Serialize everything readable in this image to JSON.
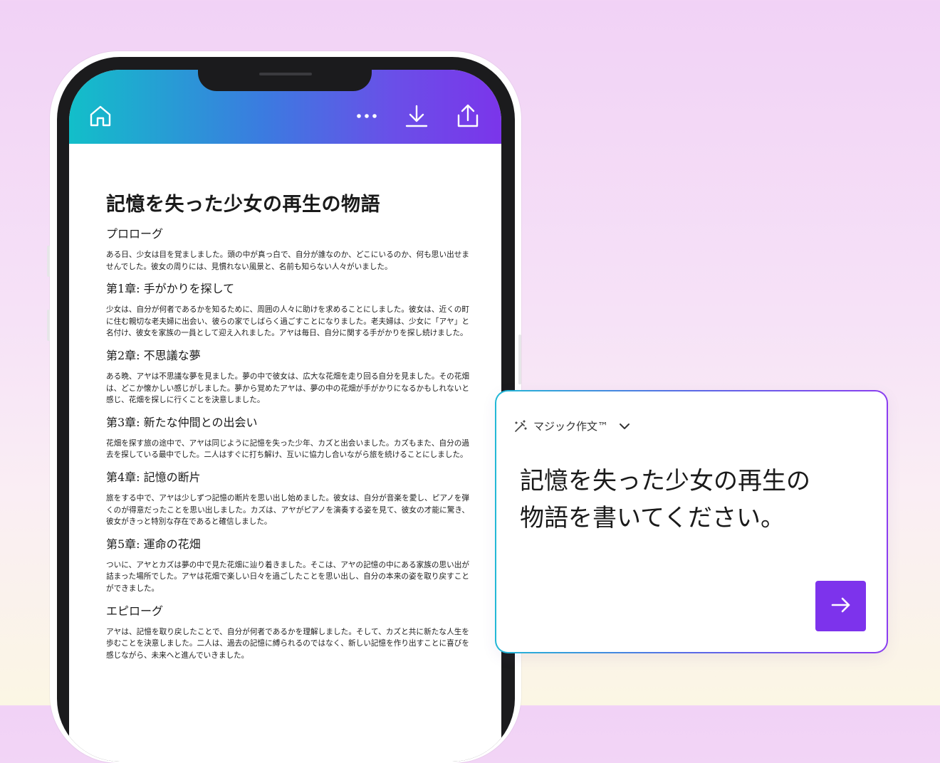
{
  "header": {
    "icons": {
      "home": "home-icon",
      "more": "more-icon",
      "download": "download-icon",
      "share": "share-icon"
    },
    "gradient": [
      "#12bfc9",
      "#7b35ea"
    ]
  },
  "document": {
    "title": "記憶を失った少女の再生の物語",
    "sections": [
      {
        "heading": "プロローグ",
        "body": "ある日、少女は目を覚ましました。頭の中が真っ白で、自分が誰なのか、どこにいるのか、何も思い出せませんでした。彼女の周りには、見慣れない風景と、名前も知らない人々がいました。"
      },
      {
        "heading": "第1章: 手がかりを探して",
        "body": "少女は、自分が何者であるかを知るために、周囲の人々に助けを求めることにしました。彼女は、近くの町に住む親切な老夫婦に出会い、彼らの家でしばらく過ごすことになりました。老夫婦は、少女に「アヤ」と名付け、彼女を家族の一員として迎え入れました。アヤは毎日、自分に関する手がかりを探し続けました。"
      },
      {
        "heading": "第2章: 不思議な夢",
        "body": "ある晩、アヤは不思議な夢を見ました。夢の中で彼女は、広大な花畑を走り回る自分を見ました。その花畑は、どこか懐かしい感じがしました。夢から覚めたアヤは、夢の中の花畑が手がかりになるかもしれないと感じ、花畑を探しに行くことを決意しました。"
      },
      {
        "heading": "第3章: 新たな仲間との出会い",
        "body": "花畑を探す旅の途中で、アヤは同じように記憶を失った少年、カズと出会いました。カズもまた、自分の過去を探している最中でした。二人はすぐに打ち解け、互いに協力し合いながら旅を続けることにしました。"
      },
      {
        "heading": "第4章: 記憶の断片",
        "body": "旅をする中で、アヤは少しずつ記憶の断片を思い出し始めました。彼女は、自分が音楽を愛し、ピアノを弾くのが得意だったことを思い出しました。カズは、アヤがピアノを演奏する姿を見て、彼女の才能に驚き、彼女がきっと特別な存在であると確信しました。"
      },
      {
        "heading": "第5章: 運命の花畑",
        "body": "ついに、アヤとカズは夢の中で見た花畑に辿り着きました。そこは、アヤの記憶の中にある家族の思い出が詰まった場所でした。アヤは花畑で楽しい日々を過ごしたことを思い出し、自分の本来の姿を取り戻すことができました。"
      },
      {
        "heading": "エピローグ",
        "body": "アヤは、記憶を取り戻したことで、自分が何者であるかを理解しました。そして、カズと共に新たな人生を歩むことを決意しました。二人は、過去の記憶に縛られるのではなく、新しい記憶を作り出すことに喜びを感じながら、未来へと進んでいきました。"
      }
    ]
  },
  "magic_write": {
    "label": "マジック作文™",
    "prompt_line1": "記憶を失った少女の再生の",
    "prompt_line2": "物語を書いてください。",
    "accent": "#7d33ec",
    "icons": {
      "wand": "magic-wand-icon",
      "chevron": "chevron-down-icon",
      "send": "arrow-right-icon"
    }
  }
}
